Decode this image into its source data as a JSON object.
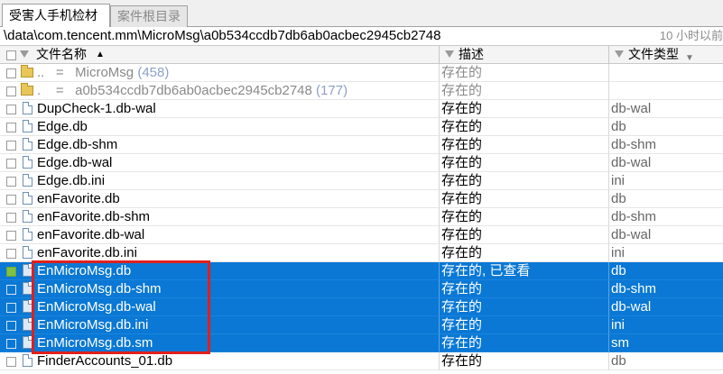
{
  "tabs": [
    {
      "label": "受害人手机检材",
      "active": true
    },
    {
      "label": "案件根目录",
      "active": false
    }
  ],
  "path": "\\data\\com.tencent.mm\\MicroMsg\\a0b534ccdb7db6ab0acbec2945cb2748",
  "status": "10 小时以前",
  "columns": {
    "name": "文件名称",
    "name_sort": "▲",
    "desc": "描述",
    "type": "文件类型",
    "type_arrow": "▼"
  },
  "rows": [
    {
      "name": "..",
      "eq": "=",
      "target": "MicroMsg",
      "count": "(458)",
      "desc": "存在的",
      "type": "",
      "kind": "folder"
    },
    {
      "name": ".",
      "eq": "=",
      "target": "a0b534ccdb7db6ab0acbec2945cb2748",
      "count": "(177)",
      "desc": "存在的",
      "type": "",
      "kind": "folder"
    },
    {
      "name": "DupCheck-1.db-wal",
      "desc": "存在的",
      "type": "db-wal",
      "kind": "file"
    },
    {
      "name": "Edge.db",
      "desc": "存在的",
      "type": "db",
      "kind": "file"
    },
    {
      "name": "Edge.db-shm",
      "desc": "存在的",
      "type": "db-shm",
      "kind": "file"
    },
    {
      "name": "Edge.db-wal",
      "desc": "存在的",
      "type": "db-wal",
      "kind": "file"
    },
    {
      "name": "Edge.db.ini",
      "desc": "存在的",
      "type": "ini",
      "kind": "file"
    },
    {
      "name": "enFavorite.db",
      "desc": "存在的",
      "type": "db",
      "kind": "file"
    },
    {
      "name": "enFavorite.db-shm",
      "desc": "存在的",
      "type": "db-shm",
      "kind": "file"
    },
    {
      "name": "enFavorite.db-wal",
      "desc": "存在的",
      "type": "db-wal",
      "kind": "file"
    },
    {
      "name": "enFavorite.db.ini",
      "desc": "存在的",
      "type": "ini",
      "kind": "file"
    },
    {
      "name": "EnMicroMsg.db",
      "desc": "存在的, 已查看",
      "type": "db",
      "kind": "file",
      "selected": true
    },
    {
      "name": "EnMicroMsg.db-shm",
      "desc": "存在的",
      "type": "db-shm",
      "kind": "file",
      "selected": true
    },
    {
      "name": "EnMicroMsg.db-wal",
      "desc": "存在的",
      "type": "db-wal",
      "kind": "file",
      "selected": true
    },
    {
      "name": "EnMicroMsg.db.ini",
      "desc": "存在的",
      "type": "ini",
      "kind": "file",
      "selected": true
    },
    {
      "name": "EnMicroMsg.db.sm",
      "desc": "存在的",
      "type": "sm",
      "kind": "file",
      "selected": true
    },
    {
      "name": "FinderAccounts_01.db",
      "desc": "存在的",
      "type": "db",
      "kind": "file"
    }
  ],
  "colors": {
    "selection": "#0a78d4",
    "highlight_box": "#e0201c"
  }
}
